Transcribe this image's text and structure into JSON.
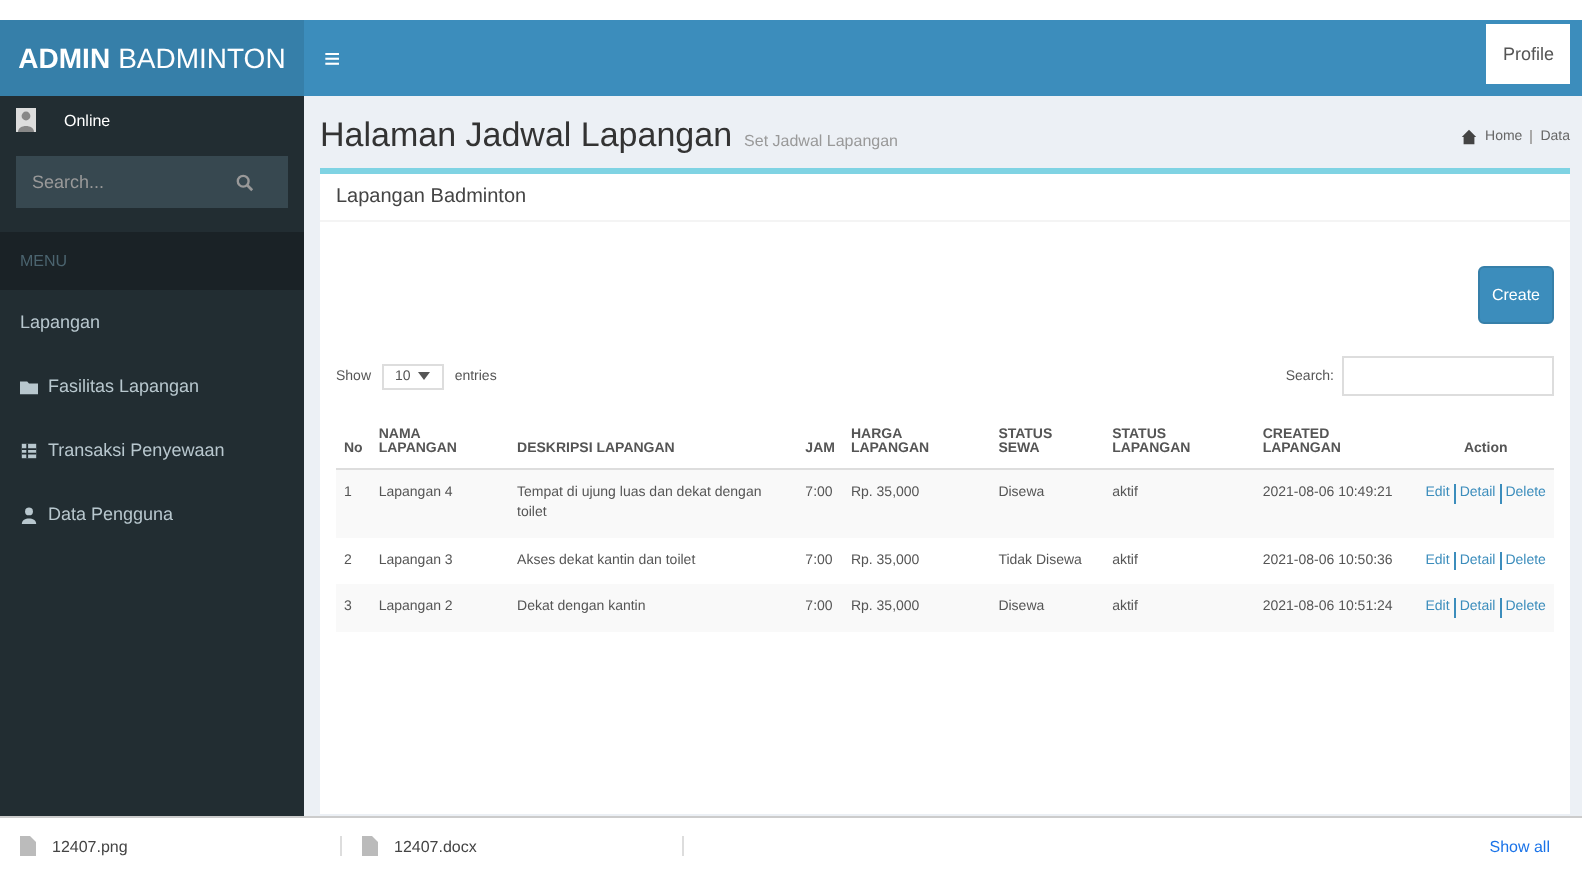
{
  "logo": {
    "bold": "ADMIN",
    "light": "BADMINTON"
  },
  "header": {
    "menu_icon": "≡",
    "profile_button": "Profile"
  },
  "sidebar": {
    "status": "Online",
    "search": {
      "placeholder": "Search..."
    },
    "section": "MENU",
    "items": [
      {
        "label": "Lapangan",
        "kind": "plain"
      },
      {
        "label": "Fasilitas Lapangan",
        "kind": "folder"
      },
      {
        "label": "Transaksi Penyewaan",
        "kind": "table"
      },
      {
        "label": "Data Pengguna",
        "kind": "user"
      }
    ]
  },
  "page": {
    "title": "Halaman Jadwal Lapangan",
    "subtitle": "Set Jadwal Lapangan",
    "breadcrumb": [
      "Home",
      "Data"
    ]
  },
  "box": {
    "title": "Lapangan Badminton",
    "create_button": "Create",
    "show_label": "Show",
    "show_value": "10",
    "entries_label": "entries",
    "search_label": "Search:"
  },
  "table": {
    "columns": [
      "No",
      "NAMA LAPANGAN",
      "DESKRIPSI LAPANGAN",
      "JAM",
      "HARGA LAPANGAN",
      "STATUS SEWA",
      "STATUS LAPANGAN",
      "CREATED LAPANGAN",
      "Action"
    ],
    "rows": [
      {
        "cells": [
          "1",
          "Lapangan 4",
          "Tempat di ujung luas dan dekat dengan toilet",
          "7:00",
          "Rp. 35,000",
          "Disewa",
          "aktif",
          "2021-08-06 10:49:21"
        ],
        "actions": [
          "Edit",
          "Detail",
          "Delete"
        ]
      },
      {
        "cells": [
          "2",
          "Lapangan 3",
          "Akses dekat kantin dan toilet",
          "7:00",
          "Rp. 35,000",
          "Tidak Disewa",
          "aktif",
          "2021-08-06 10:50:36"
        ],
        "actions": [
          "Edit",
          "Detail",
          "Delete"
        ]
      },
      {
        "cells": [
          "3",
          "Lapangan 2",
          "Dekat dengan kantin",
          "7:00",
          "Rp. 35,000",
          "Disewa",
          "aktif",
          "2021-08-06 10:51:24"
        ],
        "actions": [
          "Edit",
          "Detail",
          "Delete"
        ]
      }
    ]
  },
  "downloads": {
    "items": [
      "12407.png",
      "12407.docx"
    ],
    "show_all": "Show all"
  }
}
